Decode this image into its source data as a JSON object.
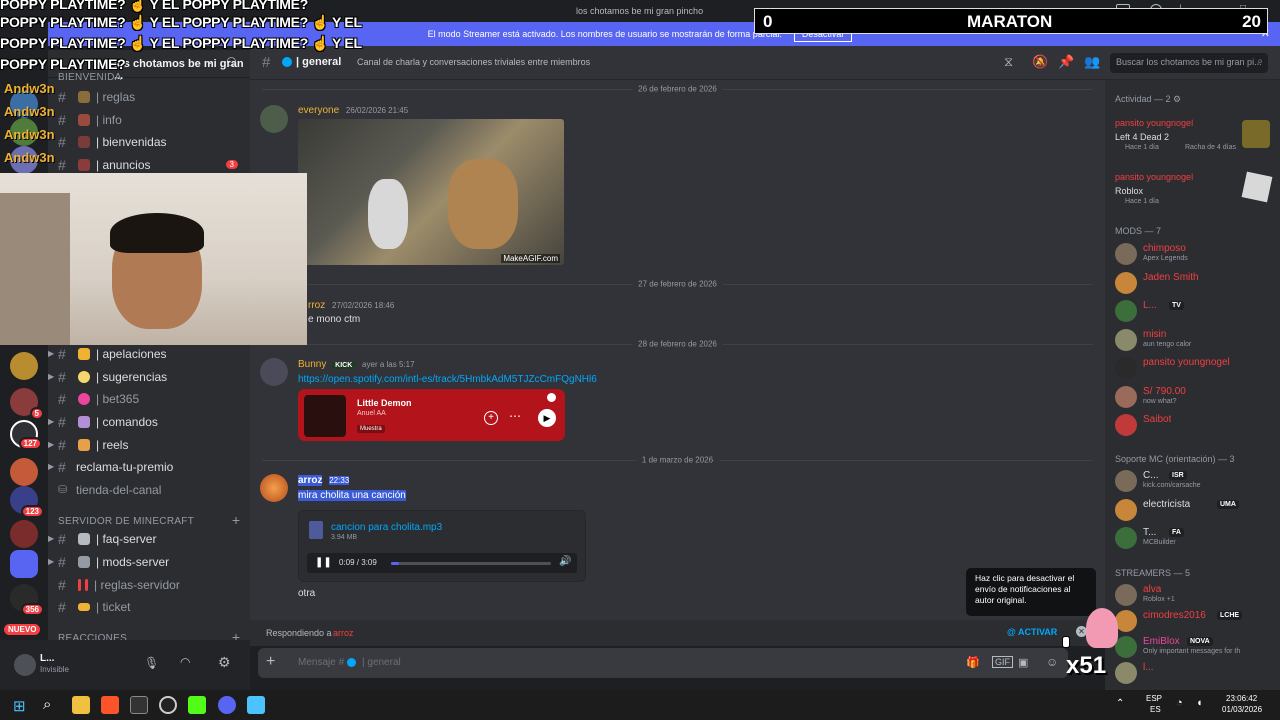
{
  "overlay": {
    "poppy_lines": [
      "POPPY PLAYTIME?",
      "Y EL POPPY PLAYTIME?",
      "Y EL POPPY PLAYTIME?",
      "Y EL"
    ],
    "poppy_line2": "POPPY PLAYTIME?",
    "poppy_line2b": "Y EL POPPY PLAYTIME?",
    "poppy_line2c": "Y EL",
    "poppy_line3": "POPPY PLAYTIME?",
    "poppy_line3b": "Y EL POPPY PLAYTIME?",
    "poppy_line3c": "Y EL",
    "poppy_line4": "POPPY PLAYTIME?",
    "chat_names": [
      "Andw3n",
      "Andw3n",
      "Andw3n",
      "Andw3n"
    ],
    "maraton_left": "0",
    "maraton_title": "MARATON",
    "maraton_right": "20",
    "x51": "x51",
    "nuevo": "NUEVO"
  },
  "titlebar": {
    "title": "los chotamos be mi gran pincho"
  },
  "streamer_bar": {
    "text": "El modo Streamer está activado. Los nombres de usuario se mostrarán de forma parcial.",
    "button": "Desactivar"
  },
  "server": {
    "name": "los chotamos be mi gran ..."
  },
  "channels": {
    "top": [
      {
        "label": "| reglas"
      },
      {
        "label": "| info"
      },
      {
        "label": "| bienvenidas"
      },
      {
        "label": "| anuncios",
        "badge": "3"
      }
    ],
    "middle": [
      {
        "label": "| apelaciones"
      },
      {
        "label": "| sugerencias"
      },
      {
        "label": "| bet365"
      },
      {
        "label": "| comandos"
      },
      {
        "label": "| reels"
      },
      {
        "label": "reclama-tu-premio"
      },
      {
        "label": "tienda-del-canal"
      }
    ],
    "cat_minecraft": "SERVIDOR DE MINECRAFT",
    "minecraft": [
      {
        "label": "| faq-server"
      },
      {
        "label": "| mods-server"
      },
      {
        "label": "| reglas-servidor"
      },
      {
        "label": "| ticket"
      }
    ],
    "cat_reacciones": "REACCIONES",
    "cat_top": "BIENVENIDA"
  },
  "server_badges": [
    "5",
    "127",
    "123",
    "356"
  ],
  "user_panel": {
    "name": "L...",
    "status": "Invisible"
  },
  "header": {
    "channel": "| general",
    "topic": "Canal de charla y conversaciones triviales entre miembros",
    "search_placeholder": "Buscar los chotamos be mi gran pi..."
  },
  "chat": {
    "date1": "26 de febrero de 2026",
    "msg1_author": "everyone",
    "msg1_time": "26/02/2026 21:45",
    "gif_watermark": "MakeAGIF.com",
    "date2": "27 de febrero de 2026",
    "msg2_author": "rroz",
    "msg2_time": "27/02/2026 18:46",
    "msg2_text": "e mono ctm",
    "date3": "28 de febrero de 2026",
    "msg3_author": "Bunny",
    "msg3_tag": "KICK",
    "msg3_time": "ayer a las 5:17",
    "msg3_link": "https://open.spotify.com/intl-es/track/5HmbkAdM5TJZcCmFQgNHl6",
    "spotify_title": "Little Demon",
    "spotify_artist": "Anuel AA",
    "spotify_label": "Muestra",
    "date4": "1 de marzo de 2026",
    "msg4_author": "arroz",
    "msg4_time": "22:33",
    "msg4_text": "mira cholita una canción",
    "file_name": "cancion para cholita.mp3",
    "file_size": "3.94 MB",
    "audio_time": "0:09 / 3:09",
    "audio_progress": 0.05,
    "msg5_text": "otra"
  },
  "reply": {
    "label": "Respondiendo a",
    "target": "arroz",
    "activate": "@ ACTIVAR"
  },
  "input": {
    "placeholder": "Mensaje #",
    "channel": "| general"
  },
  "tooltip": "Haz clic para desactivar el envío de notificaciones al autor original.",
  "members": {
    "activity_head": "Actividad — 2",
    "activities": [
      {
        "name": "pansito youngnogel",
        "game": "Left 4 Dead 2",
        "time": "Hace 1 día",
        "streak": "Racha de 4 días"
      },
      {
        "name": "pansito youngnogel",
        "game": "Roblox",
        "time": "Hace 1 día"
      }
    ],
    "mods_head": "MODS — 7",
    "mods": [
      {
        "name": "chimposo",
        "sub": "Apex Legends",
        "color": "#f23f43"
      },
      {
        "name": "Jaden Smith",
        "sub": "",
        "color": "#f23f43"
      },
      {
        "name": "L...",
        "sub": "",
        "tag": "TV",
        "color": "#f23f43"
      },
      {
        "name": "misin",
        "sub": "aun tengo calor",
        "color": "#f23f43"
      },
      {
        "name": "pansito youngnogel",
        "sub": "",
        "color": "#f23f43"
      },
      {
        "name": "S/ 790.00",
        "sub": "now what?",
        "color": "#f23f43"
      },
      {
        "name": "Saibot",
        "sub": "",
        "color": "#f23f43"
      }
    ],
    "soporte_head": "Soporte MC (orientación) — 3",
    "soporte": [
      {
        "name": "C...",
        "tag": "ISR",
        "sub": "kick.com/carsache",
        "color": "#dbdee1"
      },
      {
        "name": "electricista",
        "tag": "UMA",
        "sub": "",
        "color": "#dbdee1"
      },
      {
        "name": "T...",
        "tag": "FA",
        "sub": "MCBuilder",
        "color": "#dbdee1"
      }
    ],
    "streamers_head": "STREAMERS — 5",
    "streamers": [
      {
        "name": "alva",
        "sub": "Roblox +1",
        "color": "#f23f43"
      },
      {
        "name": "cimodres2016",
        "tag": "LCHE",
        "sub": "",
        "color": "#f23f43"
      },
      {
        "name": "EmiBlox",
        "tag": "NOVA",
        "sub": "Only important messages for th",
        "color": "#eb459e"
      },
      {
        "name": "l...",
        "sub": "",
        "color": "#f23f43"
      }
    ]
  },
  "taskbar": {
    "lang": "ESP",
    "lang2": "ES",
    "time": "23:06:42",
    "date": "01/03/2026"
  },
  "colors": {
    "blurple": "#5865f2",
    "red_name": "#f23f43",
    "link": "#00a8fc",
    "spotify_red": "#b3141b",
    "author_yellow": "#f0b232"
  }
}
